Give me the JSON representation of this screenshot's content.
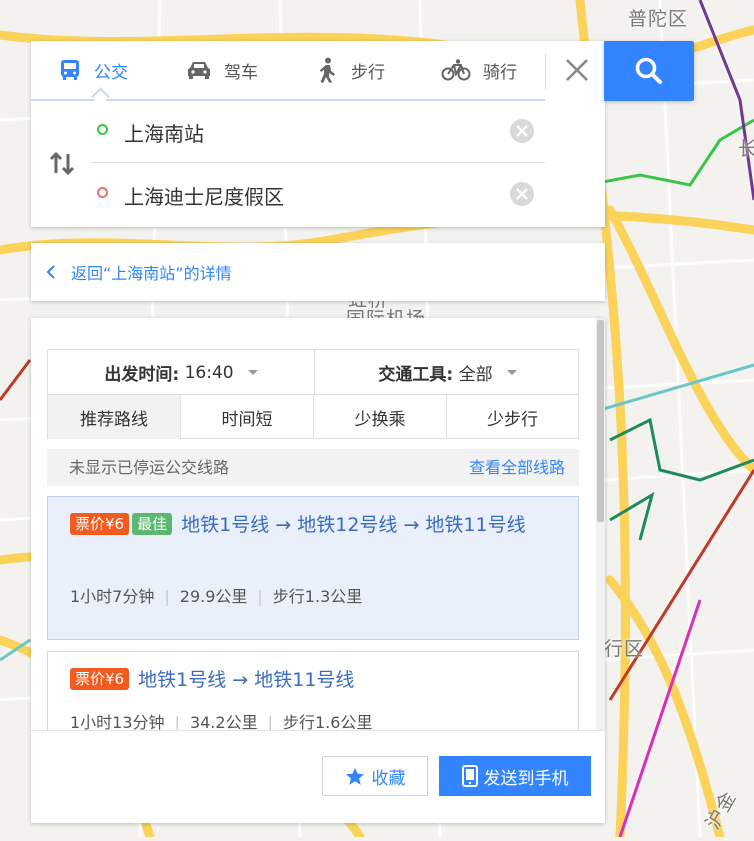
{
  "map": {
    "district_labels": [
      "普陀区",
      "长",
      "行区",
      "国际机场",
      "虹桥",
      "沪金"
    ],
    "colors": {
      "background": "#f3f2ee",
      "road": "#fbd25a",
      "line_green": "#3ac44a",
      "line_purple": "#6c3a8e",
      "line_darkgreen": "#1f8a5b",
      "line_cyan": "#6bc7c7",
      "line_magenta": "#d62fb8",
      "line_red": "#c0392b"
    }
  },
  "modes": [
    {
      "label": "公交",
      "icon": "bus-icon",
      "active": true
    },
    {
      "label": "驾车",
      "icon": "car-icon",
      "active": false
    },
    {
      "label": "步行",
      "icon": "walk-icon",
      "active": false
    },
    {
      "label": "骑行",
      "icon": "bike-icon",
      "active": false
    }
  ],
  "route": {
    "start": "上海南站",
    "end": "上海迪士尼度假区"
  },
  "back_link": "返回“上海南站”的详情",
  "filters": {
    "depart_label": "出发时间:",
    "depart_value": "16:40",
    "tool_label": "交通工具:",
    "tool_value": "全部"
  },
  "sort_tabs": [
    "推荐路线",
    "时间短",
    "少换乘",
    "少步行"
  ],
  "notice": {
    "left": "未显示已停运公交线路",
    "right": "查看全部线路"
  },
  "results": [
    {
      "price_badge": "票价¥6",
      "best_badge": "最佳",
      "line": "地铁1号线 → 地铁12号线 → 地铁11号线",
      "duration": "1小时7分钟",
      "distance": "29.9公里",
      "walk": "步行1.3公里"
    },
    {
      "price_badge": "票价¥6",
      "line": "地铁1号线 → 地铁11号线",
      "duration": "1小时13分钟",
      "distance": "34.2公里",
      "walk": "步行1.6公里"
    }
  ],
  "buttons": {
    "favorite": "收藏",
    "send": "发送到手机"
  },
  "accent": "#3385ff"
}
